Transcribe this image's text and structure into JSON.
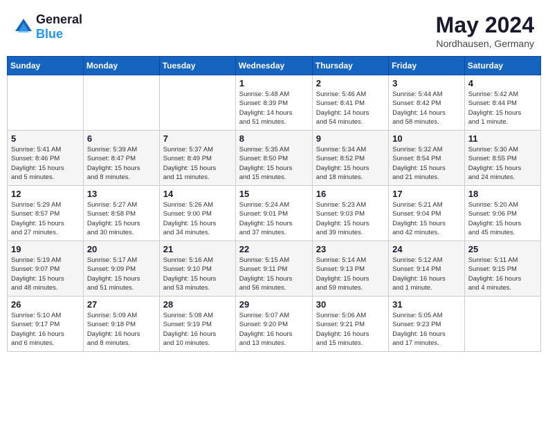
{
  "header": {
    "logo": {
      "text_general": "General",
      "text_blue": "Blue"
    },
    "month": "May 2024",
    "location": "Nordhausen, Germany"
  },
  "weekdays": [
    "Sunday",
    "Monday",
    "Tuesday",
    "Wednesday",
    "Thursday",
    "Friday",
    "Saturday"
  ],
  "weeks": [
    [
      {
        "day": "",
        "info": ""
      },
      {
        "day": "",
        "info": ""
      },
      {
        "day": "",
        "info": ""
      },
      {
        "day": "1",
        "info": "Sunrise: 5:48 AM\nSunset: 8:39 PM\nDaylight: 14 hours\nand 51 minutes."
      },
      {
        "day": "2",
        "info": "Sunrise: 5:46 AM\nSunset: 8:41 PM\nDaylight: 14 hours\nand 54 minutes."
      },
      {
        "day": "3",
        "info": "Sunrise: 5:44 AM\nSunset: 8:42 PM\nDaylight: 14 hours\nand 58 minutes."
      },
      {
        "day": "4",
        "info": "Sunrise: 5:42 AM\nSunset: 8:44 PM\nDaylight: 15 hours\nand 1 minute."
      }
    ],
    [
      {
        "day": "5",
        "info": "Sunrise: 5:41 AM\nSunset: 8:46 PM\nDaylight: 15 hours\nand 5 minutes."
      },
      {
        "day": "6",
        "info": "Sunrise: 5:39 AM\nSunset: 8:47 PM\nDaylight: 15 hours\nand 8 minutes."
      },
      {
        "day": "7",
        "info": "Sunrise: 5:37 AM\nSunset: 8:49 PM\nDaylight: 15 hours\nand 11 minutes."
      },
      {
        "day": "8",
        "info": "Sunrise: 5:35 AM\nSunset: 8:50 PM\nDaylight: 15 hours\nand 15 minutes."
      },
      {
        "day": "9",
        "info": "Sunrise: 5:34 AM\nSunset: 8:52 PM\nDaylight: 15 hours\nand 18 minutes."
      },
      {
        "day": "10",
        "info": "Sunrise: 5:32 AM\nSunset: 8:54 PM\nDaylight: 15 hours\nand 21 minutes."
      },
      {
        "day": "11",
        "info": "Sunrise: 5:30 AM\nSunset: 8:55 PM\nDaylight: 15 hours\nand 24 minutes."
      }
    ],
    [
      {
        "day": "12",
        "info": "Sunrise: 5:29 AM\nSunset: 8:57 PM\nDaylight: 15 hours\nand 27 minutes."
      },
      {
        "day": "13",
        "info": "Sunrise: 5:27 AM\nSunset: 8:58 PM\nDaylight: 15 hours\nand 30 minutes."
      },
      {
        "day": "14",
        "info": "Sunrise: 5:26 AM\nSunset: 9:00 PM\nDaylight: 15 hours\nand 34 minutes."
      },
      {
        "day": "15",
        "info": "Sunrise: 5:24 AM\nSunset: 9:01 PM\nDaylight: 15 hours\nand 37 minutes."
      },
      {
        "day": "16",
        "info": "Sunrise: 5:23 AM\nSunset: 9:03 PM\nDaylight: 15 hours\nand 39 minutes."
      },
      {
        "day": "17",
        "info": "Sunrise: 5:21 AM\nSunset: 9:04 PM\nDaylight: 15 hours\nand 42 minutes."
      },
      {
        "day": "18",
        "info": "Sunrise: 5:20 AM\nSunset: 9:06 PM\nDaylight: 15 hours\nand 45 minutes."
      }
    ],
    [
      {
        "day": "19",
        "info": "Sunrise: 5:19 AM\nSunset: 9:07 PM\nDaylight: 15 hours\nand 48 minutes."
      },
      {
        "day": "20",
        "info": "Sunrise: 5:17 AM\nSunset: 9:09 PM\nDaylight: 15 hours\nand 51 minutes."
      },
      {
        "day": "21",
        "info": "Sunrise: 5:16 AM\nSunset: 9:10 PM\nDaylight: 15 hours\nand 53 minutes."
      },
      {
        "day": "22",
        "info": "Sunrise: 5:15 AM\nSunset: 9:11 PM\nDaylight: 15 hours\nand 56 minutes."
      },
      {
        "day": "23",
        "info": "Sunrise: 5:14 AM\nSunset: 9:13 PM\nDaylight: 15 hours\nand 59 minutes."
      },
      {
        "day": "24",
        "info": "Sunrise: 5:12 AM\nSunset: 9:14 PM\nDaylight: 16 hours\nand 1 minute."
      },
      {
        "day": "25",
        "info": "Sunrise: 5:11 AM\nSunset: 9:15 PM\nDaylight: 16 hours\nand 4 minutes."
      }
    ],
    [
      {
        "day": "26",
        "info": "Sunrise: 5:10 AM\nSunset: 9:17 PM\nDaylight: 16 hours\nand 6 minutes."
      },
      {
        "day": "27",
        "info": "Sunrise: 5:09 AM\nSunset: 9:18 PM\nDaylight: 16 hours\nand 8 minutes."
      },
      {
        "day": "28",
        "info": "Sunrise: 5:08 AM\nSunset: 9:19 PM\nDaylight: 16 hours\nand 10 minutes."
      },
      {
        "day": "29",
        "info": "Sunrise: 5:07 AM\nSunset: 9:20 PM\nDaylight: 16 hours\nand 13 minutes."
      },
      {
        "day": "30",
        "info": "Sunrise: 5:06 AM\nSunset: 9:21 PM\nDaylight: 16 hours\nand 15 minutes."
      },
      {
        "day": "31",
        "info": "Sunrise: 5:05 AM\nSunset: 9:23 PM\nDaylight: 16 hours\nand 17 minutes."
      },
      {
        "day": "",
        "info": ""
      }
    ]
  ]
}
